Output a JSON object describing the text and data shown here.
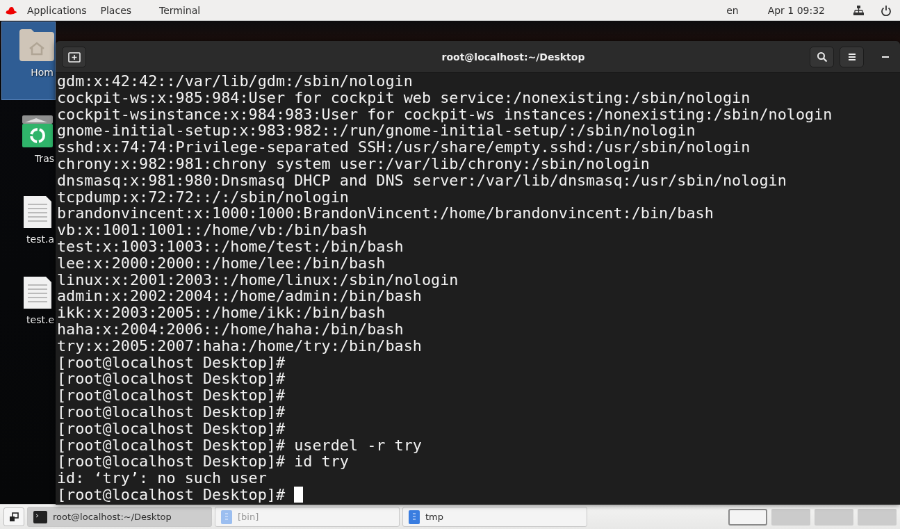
{
  "top_bar": {
    "menus": [
      "Applications",
      "Places",
      "Terminal"
    ],
    "language": "en",
    "clock": "Apr 1  09:32"
  },
  "desktop_icons": [
    {
      "kind": "folder",
      "label": "Hom",
      "selected": true
    },
    {
      "kind": "trash",
      "label": "Tras",
      "selected": false
    },
    {
      "kind": "document",
      "label": "test.a",
      "selected": false
    },
    {
      "kind": "document",
      "label": "test.e",
      "selected": false
    }
  ],
  "terminal": {
    "title": "root@localhost:~/Desktop",
    "lines": [
      "gdm:x:42:42::/var/lib/gdm:/sbin/nologin",
      "cockpit-ws:x:985:984:User for cockpit web service:/nonexisting:/sbin/nologin",
      "cockpit-wsinstance:x:984:983:User for cockpit-ws instances:/nonexisting:/sbin/nologin",
      "gnome-initial-setup:x:983:982::/run/gnome-initial-setup/:/sbin/nologin",
      "sshd:x:74:74:Privilege-separated SSH:/usr/share/empty.sshd:/usr/sbin/nologin",
      "chrony:x:982:981:chrony system user:/var/lib/chrony:/sbin/nologin",
      "dnsmasq:x:981:980:Dnsmasq DHCP and DNS server:/var/lib/dnsmasq:/usr/sbin/nologin",
      "tcpdump:x:72:72::/:/sbin/nologin",
      "brandonvincent:x:1000:1000:BrandonVincent:/home/brandonvincent:/bin/bash",
      "vb:x:1001:1001::/home/vb:/bin/bash",
      "test:x:1003:1003::/home/test:/bin/bash",
      "lee:x:2000:2000::/home/lee:/bin/bash",
      "linux:x:2001:2003::/home/linux:/sbin/nologin",
      "admin:x:2002:2004::/home/admin:/bin/bash",
      "ikk:x:2003:2005::/home/ikk:/bin/bash",
      "haha:x:2004:2006::/home/haha:/bin/bash",
      "try:x:2005:2007:haha:/home/try:/bin/bash",
      "[root@localhost Desktop]#",
      "[root@localhost Desktop]#",
      "[root@localhost Desktop]#",
      "[root@localhost Desktop]#",
      "[root@localhost Desktop]#",
      "[root@localhost Desktop]# userdel -r try",
      "[root@localhost Desktop]# id try",
      "id: ‘try’: no such user",
      "[root@localhost Desktop]# "
    ]
  },
  "taskbar": {
    "windows": [
      {
        "kind": "terminal",
        "label": "root@localhost:~/Desktop",
        "active": true,
        "minimized": false
      },
      {
        "kind": "folder",
        "label": "[bin]",
        "active": false,
        "minimized": true
      },
      {
        "kind": "folder",
        "label": "tmp",
        "active": false,
        "minimized": false
      }
    ],
    "workspaces": [
      {
        "selected": true
      },
      {
        "selected": false
      },
      {
        "selected": false
      },
      {
        "selected": false
      }
    ]
  }
}
